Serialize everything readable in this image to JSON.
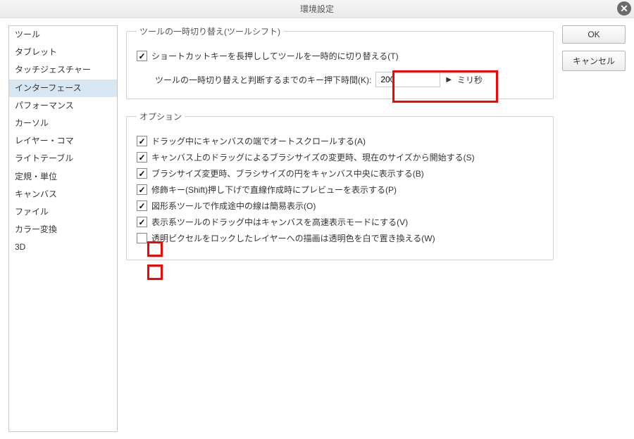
{
  "window": {
    "title": "環境設定",
    "close_label": "✕"
  },
  "sidebar": {
    "items": [
      {
        "label": "ツール",
        "selected": false
      },
      {
        "label": "タブレット",
        "selected": false
      },
      {
        "label": "タッチジェスチャー",
        "selected": false
      },
      {
        "label": "インターフェース",
        "selected": true
      },
      {
        "label": "パフォーマンス",
        "selected": false
      },
      {
        "label": "カーソル",
        "selected": false
      },
      {
        "label": "レイヤー・コマ",
        "selected": false
      },
      {
        "label": "ライトテーブル",
        "selected": false
      },
      {
        "label": "定規・単位",
        "selected": false
      },
      {
        "label": "キャンバス",
        "selected": false
      },
      {
        "label": "ファイル",
        "selected": false
      },
      {
        "label": "カラー変換",
        "selected": false
      },
      {
        "label": "3D",
        "selected": false
      }
    ]
  },
  "buttons": {
    "ok": "OK",
    "cancel": "キャンセル"
  },
  "group_toolshift": {
    "legend": "ツールの一時切り替え(ツールシフト)",
    "check_temp_switch": {
      "label": "ショートカットキーを長押ししてツールを一時的に切り替える(T)",
      "checked": true
    },
    "duration_label": "ツールの一時切り替えと判断するまでのキー押下時間(K):",
    "duration_value": "200",
    "duration_unit": "ミリ秒"
  },
  "group_options": {
    "legend": "オプション",
    "items": [
      {
        "label": "ドラッグ中にキャンバスの端でオートスクロールする(A)",
        "checked": true
      },
      {
        "label": "キャンバス上のドラッグによるブラシサイズの変更時、現在のサイズから開始する(S)",
        "checked": true
      },
      {
        "label": "ブラシサイズ変更時、ブラシサイズの円をキャンバス中央に表示する(B)",
        "checked": true
      },
      {
        "label": "修飾キー(Shift)押し下げで直線作成時にプレビューを表示する(P)",
        "checked": true
      },
      {
        "label": "図形系ツールで作成途中の線は簡易表示(O)",
        "checked": true
      },
      {
        "label": "表示系ツールのドラッグ中はキャンバスを高速表示モードにする(V)",
        "checked": true
      },
      {
        "label": "透明ピクセルをロックしたレイヤーへの描画は透明色を白で置き換える(W)",
        "checked": false
      }
    ]
  }
}
